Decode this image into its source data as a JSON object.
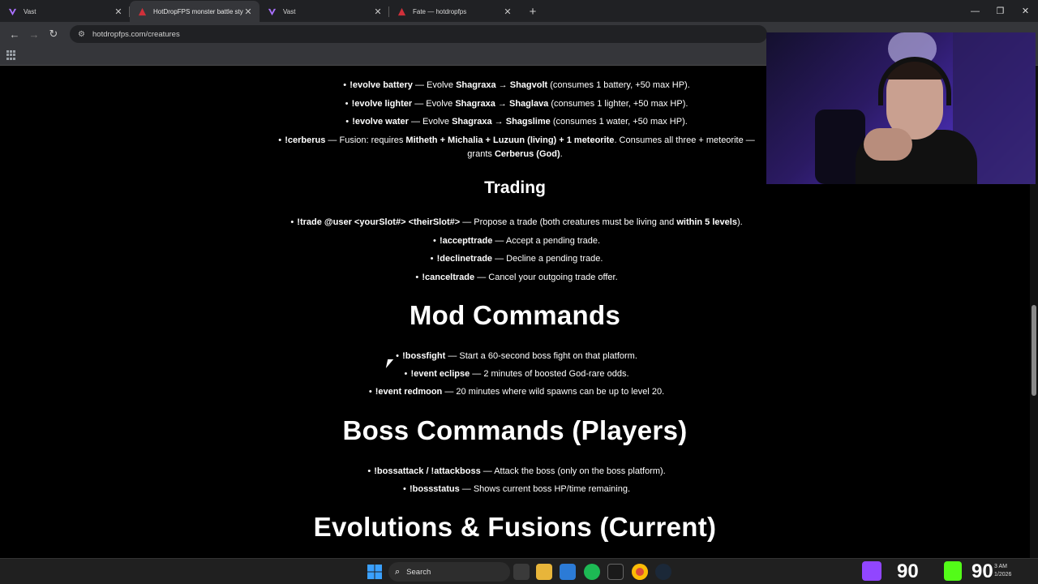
{
  "browser": {
    "tabs": [
      {
        "title": "Vast",
        "favicon": "vast-icon",
        "active": false
      },
      {
        "title": "HotDropFPS monster battle style",
        "favicon": "hotdrop-icon",
        "active": true
      },
      {
        "title": "Vast",
        "favicon": "vast-icon",
        "active": false
      },
      {
        "title": "Fate — hotdropfps",
        "favicon": "hotdrop-icon",
        "active": false
      }
    ],
    "new_tab_label": "+",
    "url": "hotdropfps.com/creatures",
    "window_controls": {
      "minimize": "—",
      "restore": "❐",
      "close": "✕"
    }
  },
  "content": {
    "evolve_lines": [
      {
        "cmd": "!evolve battery",
        "mid": " — Evolve ",
        "from": "Shagraxa",
        "arrow": " → ",
        "to": "Shagvolt",
        "tail": " (consumes 1 battery, +50 max HP)."
      },
      {
        "cmd": "!evolve lighter",
        "mid": " — Evolve ",
        "from": "Shagraxa",
        "arrow": " → ",
        "to": "Shaglava",
        "tail": " (consumes 1 lighter, +50 max HP)."
      },
      {
        "cmd": "!evolve water",
        "mid": " — Evolve ",
        "from": "Shagraxa",
        "arrow": " → ",
        "to": "Shagslime",
        "tail": " (consumes 1 water, +50 max HP)."
      }
    ],
    "cerberus": {
      "cmd": "!cerberus",
      "text1": " — Fusion: requires ",
      "req": "Mitheth + Michalia + Luzuun (living) + 1 meteorite",
      "text2": ". Consumes all three + meteorite —",
      "text3": "grants ",
      "grant": "Cerberus (God)",
      "end": "."
    },
    "trading_heading": "Trading",
    "trade": {
      "cmd": "!trade @user <yourSlot#> <theirSlot#>",
      "text": " — Propose a trade (both creatures must be living and ",
      "bold": "within 5 levels",
      "end": ")."
    },
    "trade_lines": [
      {
        "cmd": "!accepttrade",
        "text": " — Accept a pending trade."
      },
      {
        "cmd": "!declinetrade",
        "text": " — Decline a pending trade."
      },
      {
        "cmd": "!canceltrade",
        "text": " — Cancel your outgoing trade offer."
      }
    ],
    "mod_heading": "Mod Commands",
    "mod_lines": [
      {
        "cmd": "!bossfight",
        "text": " — Start a 60-second boss fight on that platform."
      },
      {
        "cmd": "!event eclipse",
        "text": " — 2 minutes of boosted God-rare odds."
      },
      {
        "cmd": "!event redmoon",
        "text": " — 20 minutes where wild spawns can be up to level 20."
      }
    ],
    "boss_heading": "Boss Commands (Players)",
    "boss_lines": [
      {
        "cmd": "!bossattack / !attackboss",
        "text": " — Attack the boss (only on the boss platform)."
      },
      {
        "cmd": "!bossstatus",
        "text": " — Shows current boss HP/time remaining."
      }
    ],
    "evo_heading": "Evolutions & Fusions (Current)",
    "bullet": "•"
  },
  "taskbar": {
    "search_placeholder": "Search",
    "counter_left": "90",
    "counter_right": "90",
    "clock_time": "3 AM",
    "clock_date": "1/2026"
  },
  "colors": {
    "page_bg": "#000000",
    "chrome_dark": "#202124",
    "chrome_toolbar": "#35363a",
    "twitch": "#9146ff",
    "kick": "#53fc18"
  }
}
